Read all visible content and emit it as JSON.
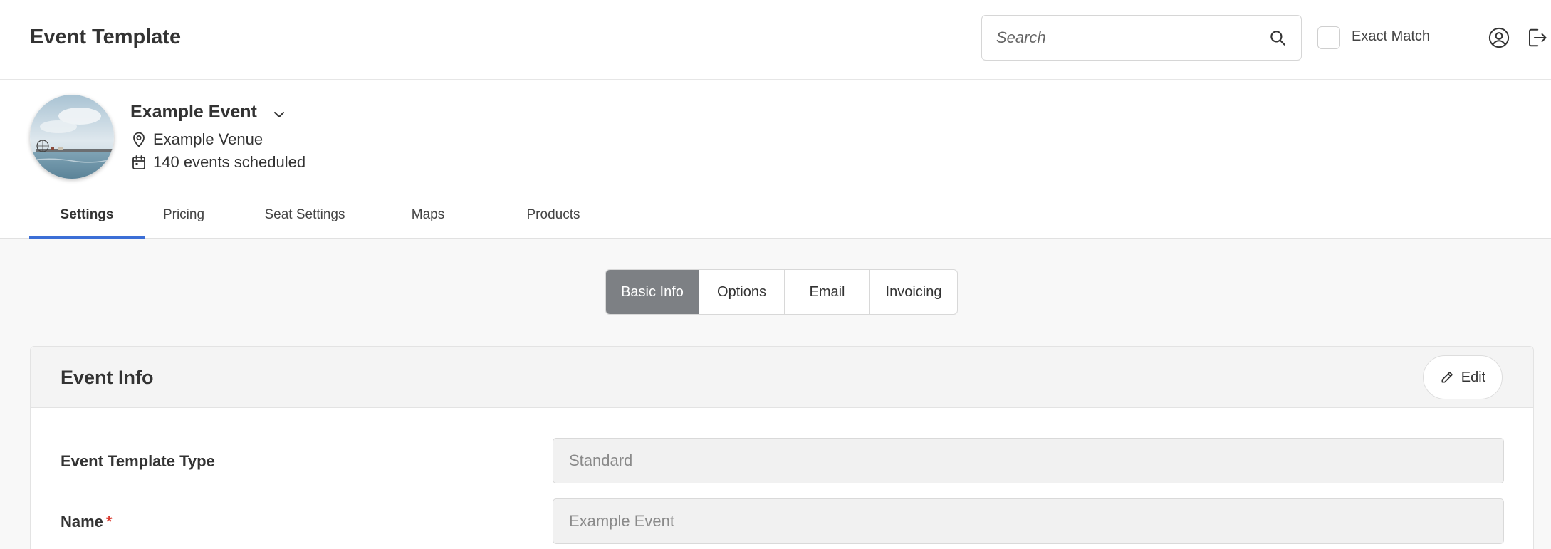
{
  "header": {
    "title": "Event Template",
    "search_placeholder": "Search",
    "exact_match_label": "Exact Match"
  },
  "event": {
    "name": "Example Event",
    "venue": "Example Venue",
    "scheduled": "140 events scheduled"
  },
  "tabs": [
    {
      "label": "Settings",
      "active": true
    },
    {
      "label": "Pricing",
      "active": false
    },
    {
      "label": "Seat Settings",
      "active": false
    },
    {
      "label": "Maps",
      "active": false
    },
    {
      "label": "Products",
      "active": false
    }
  ],
  "subtabs": [
    {
      "label": "Basic Info",
      "active": true
    },
    {
      "label": "Options",
      "active": false
    },
    {
      "label": "Email",
      "active": false
    },
    {
      "label": "Invoicing",
      "active": false
    }
  ],
  "card": {
    "title": "Event Info",
    "edit_label": "Edit",
    "fields": [
      {
        "label": "Event Template Type",
        "value": "Standard",
        "required": false
      },
      {
        "label": "Name",
        "value": "Example Event",
        "required": true
      }
    ],
    "required_marker": "*"
  },
  "colors": {
    "accent": "#3b6ed6",
    "active_segment": "#7d8084",
    "required": "#d9382e"
  }
}
